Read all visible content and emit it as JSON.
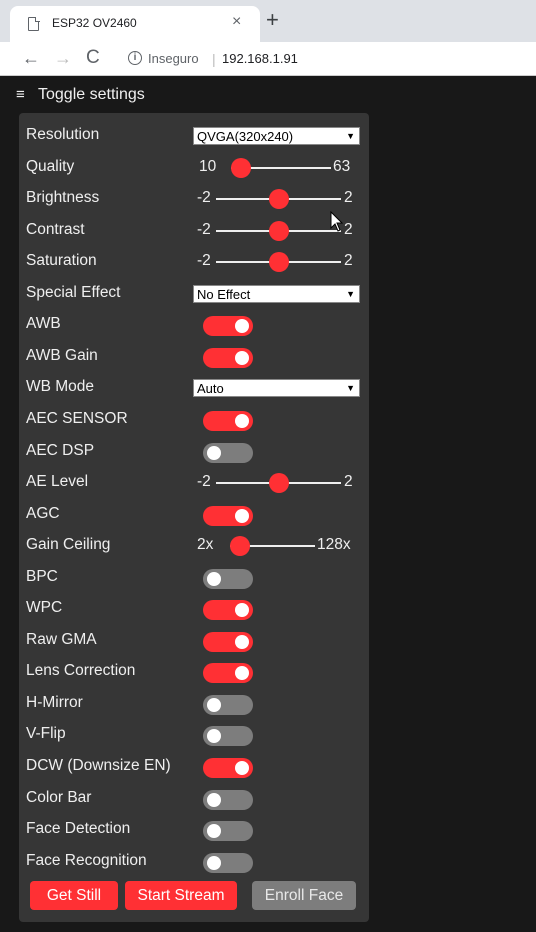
{
  "browser": {
    "tab_title": "ESP32 OV2460",
    "close_glyph": "×",
    "newtab_glyph": "+",
    "back_glyph": "←",
    "forward_glyph": "→",
    "reload_glyph": "C",
    "info_glyph": "i",
    "security_label": "Inseguro",
    "separator": "|",
    "url": "192.168.1.91"
  },
  "page": {
    "toggle_icon": "menu-icon",
    "toggle_glyph": "≡",
    "toggle_label": "Toggle settings"
  },
  "colors": {
    "accent": "#ff3034",
    "switch_off": "#7d7d7d",
    "panel": "#363636",
    "background": "#181818"
  },
  "controls": [
    {
      "type": "select",
      "name": "resolution",
      "label": "Resolution",
      "value": "QVGA(320x240)"
    },
    {
      "type": "slider",
      "name": "quality",
      "label": "Quality",
      "min": "10",
      "max": "63",
      "fraction": 0.0
    },
    {
      "type": "slider",
      "name": "brightness",
      "label": "Brightness",
      "min": "-2",
      "max": "2",
      "fraction": 0.5
    },
    {
      "type": "slider",
      "name": "contrast",
      "label": "Contrast",
      "min": "-2",
      "max": "2",
      "fraction": 0.5
    },
    {
      "type": "slider",
      "name": "saturation",
      "label": "Saturation",
      "min": "-2",
      "max": "2",
      "fraction": 0.5
    },
    {
      "type": "select",
      "name": "special-effect",
      "label": "Special Effect",
      "value": "No Effect"
    },
    {
      "type": "switch",
      "name": "awb",
      "label": "AWB",
      "on": true
    },
    {
      "type": "switch",
      "name": "awb-gain",
      "label": "AWB Gain",
      "on": true
    },
    {
      "type": "select",
      "name": "wb-mode",
      "label": "WB Mode",
      "value": "Auto"
    },
    {
      "type": "switch",
      "name": "aec-sensor",
      "label": "AEC SENSOR",
      "on": true
    },
    {
      "type": "switch",
      "name": "aec-dsp",
      "label": "AEC DSP",
      "on": false
    },
    {
      "type": "slider",
      "name": "ae-level",
      "label": "AE Level",
      "min": "-2",
      "max": "2",
      "fraction": 0.5
    },
    {
      "type": "switch",
      "name": "agc",
      "label": "AGC",
      "on": true
    },
    {
      "type": "slider",
      "name": "gain-ceiling",
      "label": "Gain Ceiling",
      "min": "2x",
      "max": "128x",
      "fraction": 0.0
    },
    {
      "type": "switch",
      "name": "bpc",
      "label": "BPC",
      "on": false
    },
    {
      "type": "switch",
      "name": "wpc",
      "label": "WPC",
      "on": true
    },
    {
      "type": "switch",
      "name": "raw-gma",
      "label": "Raw GMA",
      "on": true
    },
    {
      "type": "switch",
      "name": "lens-correction",
      "label": "Lens Correction",
      "on": true
    },
    {
      "type": "switch",
      "name": "h-mirror",
      "label": "H-Mirror",
      "on": false
    },
    {
      "type": "switch",
      "name": "v-flip",
      "label": "V-Flip",
      "on": false
    },
    {
      "type": "switch",
      "name": "dcw",
      "label": "DCW (Downsize EN)",
      "on": true
    },
    {
      "type": "switch",
      "name": "color-bar",
      "label": "Color Bar",
      "on": false
    },
    {
      "type": "switch",
      "name": "face-detection",
      "label": "Face Detection",
      "on": false
    },
    {
      "type": "switch",
      "name": "face-recognition",
      "label": "Face Recognition",
      "on": false
    }
  ],
  "buttons": {
    "get_still": "Get Still",
    "start_stream": "Start Stream",
    "enroll_face": "Enroll Face"
  }
}
